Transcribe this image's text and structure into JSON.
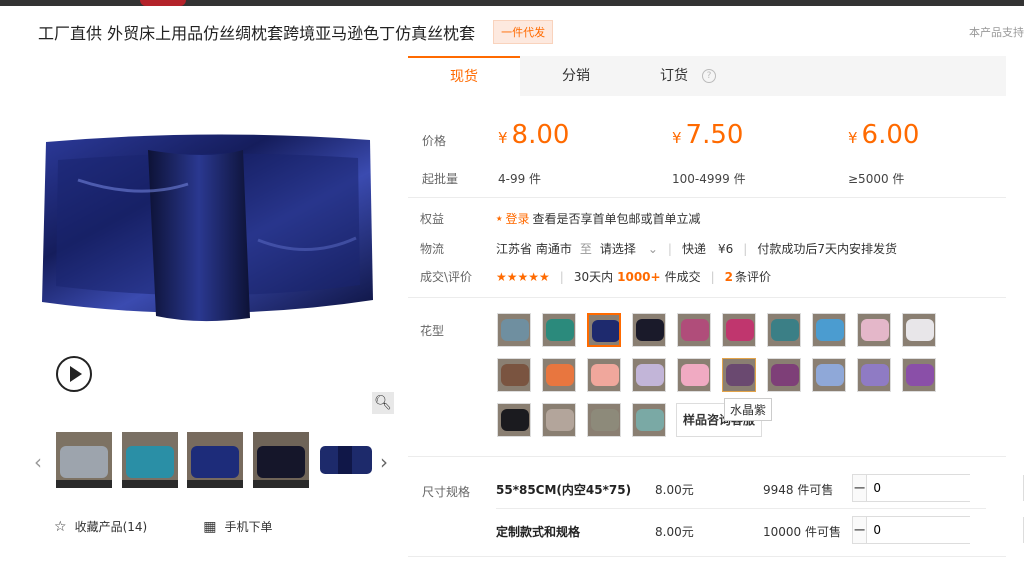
{
  "header": {
    "title": "工厂直供 外贸床上用品仿丝绸枕套跨境亚马逊色丁仿真丝枕套",
    "badge": "一件代发",
    "right_note": "本产品支持"
  },
  "tabs": [
    {
      "label": "现货",
      "active": true
    },
    {
      "label": "分销",
      "active": false
    },
    {
      "label": "订货",
      "active": false,
      "help_icon": "?"
    }
  ],
  "price": {
    "label": "价格",
    "currency": "¥",
    "tiers": [
      {
        "value": "8.00",
        "qty": "4-99 件"
      },
      {
        "value": "7.50",
        "qty": "100-4999 件"
      },
      {
        "value": "6.00",
        "qty": "≥5000 件"
      }
    ],
    "moq_label": "起批量"
  },
  "benefits": {
    "label": "权益",
    "login": "登录",
    "text": "查看是否享首单包邮或首单立减"
  },
  "logistics": {
    "label": "物流",
    "from": "江苏省 南通市",
    "to_word": "至",
    "select": "请选择",
    "shipping": "快递",
    "fee": "¥6",
    "note": "付款成功后7天内安排发货"
  },
  "reviews": {
    "label": "成交\\评价",
    "stars": "★★★★★",
    "rating": 5,
    "period": "30天内",
    "count": "1000+",
    "suffix": "件成交",
    "review_count": "2",
    "review_suffix": "条评价"
  },
  "swatches": {
    "label": "花型",
    "tooltip": "水晶紫",
    "sample_button": "样品咨询客服",
    "colors": [
      "#6f8fa0",
      "#2b8a7c",
      "#1e2a6e",
      "#1a1a2a",
      "#b04d7a",
      "#c0366e",
      "#3b7f86",
      "#4b9cd0",
      "#e4b7c9",
      "#e8e6e9",
      "#7a5440",
      "#e8763f",
      "#f0a79c",
      "#c2b5d8",
      "#f0aac2",
      "#6a4970",
      "#7e3f78",
      "#8fa8d8",
      "#8f7bc4",
      "#8a4fa8",
      "#1b1b1f",
      "#b3a59b",
      "#8d8a7a",
      "#7aa9a5"
    ],
    "selected_index": 2,
    "hover_index": 15
  },
  "specs": {
    "label": "尺寸规格",
    "rows": [
      {
        "name": "55*85CM(内空45*75)",
        "price": "8.00元",
        "stock": "9948 件可售",
        "qty": "0"
      },
      {
        "name": "定制款式和规格",
        "price": "8.00元",
        "stock": "10000 件可售",
        "qty": "0"
      }
    ]
  },
  "actions": {
    "favorite": "收藏产品(14)",
    "mobile": "手机下单"
  },
  "thumbnails": [
    {
      "color": "#9da4ad"
    },
    {
      "color": "#2a8fa6"
    },
    {
      "color": "#1d2c7a"
    },
    {
      "color": "#15162a"
    },
    {
      "color": "#1d2a6b"
    }
  ],
  "icons": {
    "play": "play-icon",
    "zoom": "zoom-icon",
    "star": "star-icon",
    "qr": "qr-icon",
    "arrow_left": "chevron-left-icon",
    "arrow_right": "chevron-right-icon"
  }
}
